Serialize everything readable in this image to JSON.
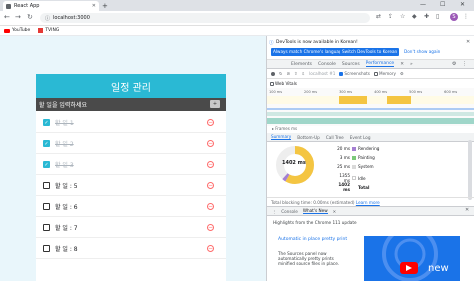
{
  "browser": {
    "tab_title": "React App",
    "url": "localhost:3000",
    "bookmarks": [
      {
        "label": "YouTube"
      },
      {
        "label": "TVING"
      }
    ]
  },
  "app": {
    "title": "일정 관리",
    "input_placeholder": "할 일을 입력하세요",
    "add_button": "+",
    "todos": [
      {
        "text": "할 일 1",
        "checked": true
      },
      {
        "text": "할 일 2",
        "checked": true
      },
      {
        "text": "할 일 3",
        "checked": true
      },
      {
        "text": "할 일 : 5",
        "checked": false
      },
      {
        "text": "할 일 : 6",
        "checked": false
      },
      {
        "text": "할 일 : 7",
        "checked": false
      },
      {
        "text": "할 일 : 8",
        "checked": false
      }
    ]
  },
  "devtools": {
    "info_message": "DevTools is now available in Korean!",
    "btn_match": "Always match Chrome's language",
    "btn_switch": "Switch DevTools to Korean",
    "btn_dont_show": "Don't show again",
    "tabs": [
      "Elements",
      "Console",
      "Sources",
      "Performance"
    ],
    "active_tab": "Performance",
    "target": "localhost #1",
    "screenshots_label": "Screenshots",
    "memory_label": "Memory",
    "web_vitals_label": "Web Vitals",
    "frames_label": "Frames ms",
    "timeline_ticks": [
      "100 ms",
      "200 ms",
      "300 ms",
      "400 ms",
      "500 ms",
      "600 ms"
    ],
    "subtabs": [
      "Summary",
      "Bottom-Up",
      "Call Tree",
      "Event Log"
    ],
    "active_subtab": "Summary",
    "total_ms": "1402 ms",
    "legend": [
      {
        "ms": "20 ms",
        "label": "Rendering",
        "color": "#a57fd2"
      },
      {
        "ms": "3 ms",
        "label": "Painting",
        "color": "#7cc979"
      },
      {
        "ms": "25 ms",
        "label": "System",
        "color": "#d9d9d9"
      },
      {
        "ms": "1355 ms",
        "label": "Idle",
        "color": "#ffffff"
      },
      {
        "ms": "1402 ms",
        "label": "Total",
        "color": ""
      }
    ],
    "blocking_text": "Total blocking time: 0.00ms (estimated)",
    "learn_more": "Learn more",
    "drawer_tabs": [
      "Console",
      "What's New"
    ],
    "active_drawer": "What's New",
    "highlights": "Highlights from the Chrome 111 update",
    "news_title": "Automatic in place pretty print",
    "news_desc": "The Sources panel now automatically pretty prints minified source files in place.",
    "promo_text": "new"
  }
}
